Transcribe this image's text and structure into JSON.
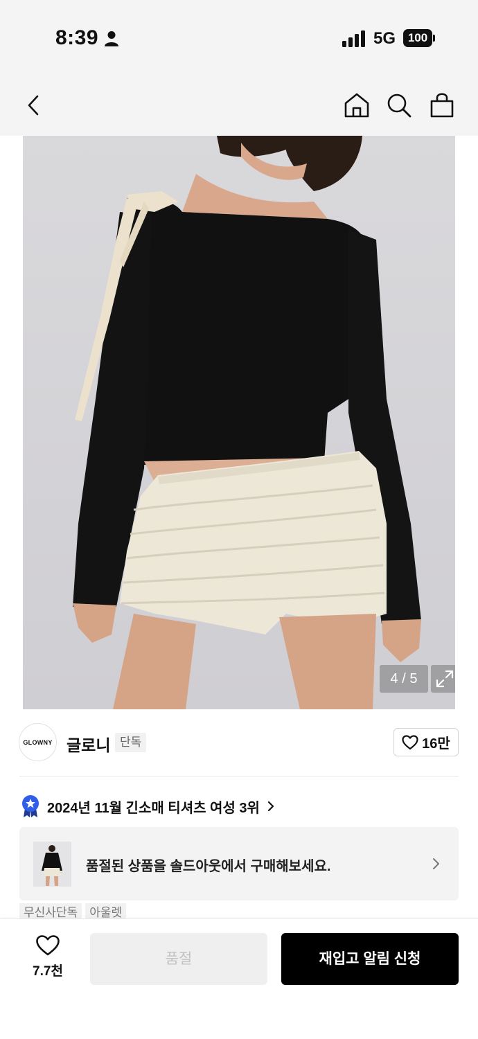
{
  "status_bar": {
    "time": "8:39",
    "network": "5G",
    "battery": "100"
  },
  "nav": {
    "icons": [
      "back-icon",
      "home-icon",
      "search-icon",
      "bag-icon"
    ]
  },
  "gallery": {
    "counter": "4 / 5",
    "current_index": 4,
    "total_images": 5
  },
  "brand": {
    "logo_text": "GLOWNY",
    "name": "글로니",
    "badge": "단독",
    "likes": "16만"
  },
  "ranking": {
    "text": "2024년 11월 긴소매 티셔츠 여성 3위"
  },
  "soldout_banner": {
    "text": "품절된 상품을 솔드아웃에서 구매해보세요."
  },
  "tags": [
    "무신사단독",
    "아울렛"
  ],
  "bottom_bar": {
    "wish_count": "7.7천",
    "soldout_label": "품절",
    "restock_label": "재입고 알림 신청"
  },
  "colors": {
    "primary_button": "#000000",
    "disabled_button": "#efefef",
    "rank_badge": "#2f5fe8"
  }
}
